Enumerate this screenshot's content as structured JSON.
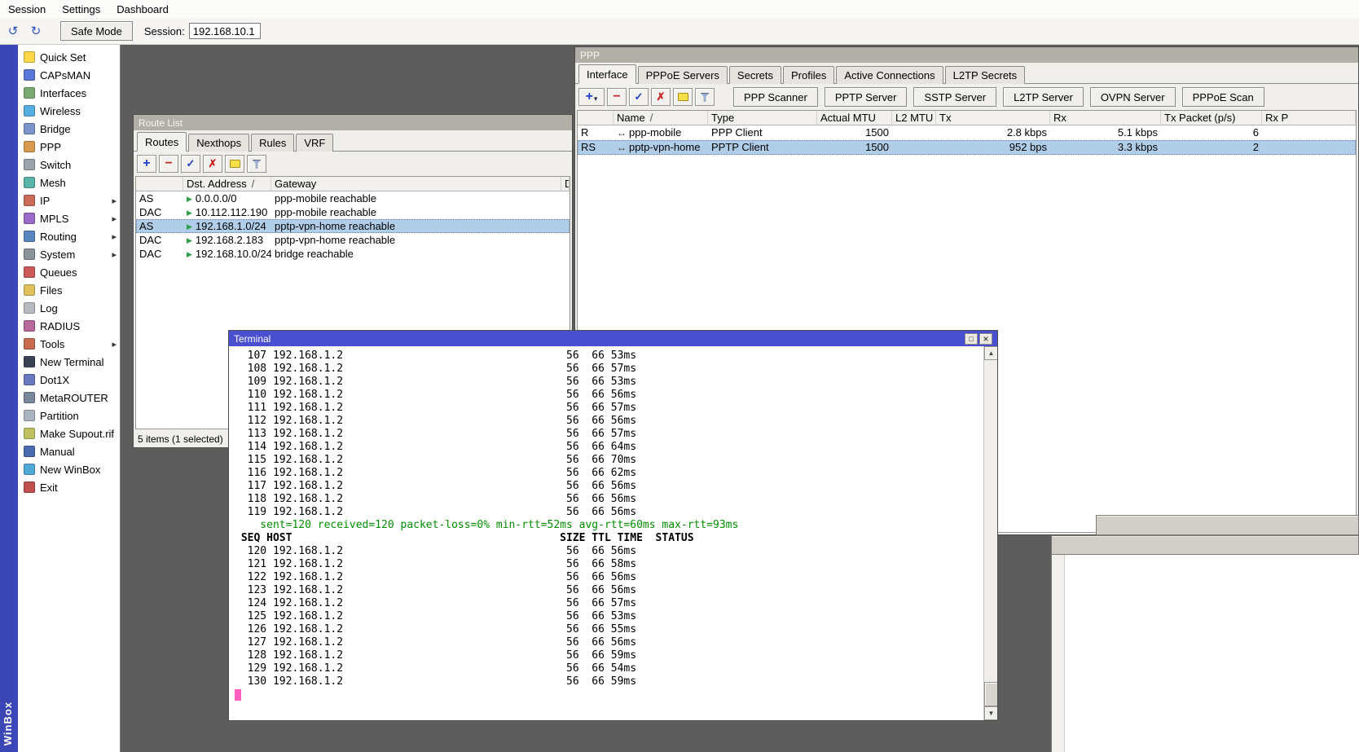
{
  "colors": {
    "workspace_bg": "#5d5d5d",
    "active_titlebar_blue": "#4a4fd0",
    "inactive_titlebar_gray": "#b2afa8",
    "selection_blue": "#b1cee9",
    "terminal_stats_green": "#008f00",
    "terminal_cursor_pink": "#ff5fbf",
    "brand_strip_blue": "#3b47b6"
  },
  "menubar": {
    "items": [
      {
        "label": "Session"
      },
      {
        "label": "Settings"
      },
      {
        "label": "Dashboard"
      }
    ]
  },
  "toolbar": {
    "safe_mode_label": "Safe Mode",
    "session_label": "Session:",
    "session_value": "192.168.10.1"
  },
  "sidebar": {
    "brand_vertical": "WinBox",
    "items": [
      {
        "label": "Quick Set",
        "icon": "quick-set",
        "arrow": ""
      },
      {
        "label": "CAPsMAN",
        "icon": "capsman",
        "arrow": ""
      },
      {
        "label": "Interfaces",
        "icon": "interfaces",
        "arrow": ""
      },
      {
        "label": "Wireless",
        "icon": "wireless",
        "arrow": ""
      },
      {
        "label": "Bridge",
        "icon": "bridge",
        "arrow": ""
      },
      {
        "label": "PPP",
        "icon": "ppp",
        "arrow": ""
      },
      {
        "label": "Switch",
        "icon": "switch",
        "arrow": ""
      },
      {
        "label": "Mesh",
        "icon": "mesh",
        "arrow": ""
      },
      {
        "label": "IP",
        "icon": "ip",
        "arrow": "▸"
      },
      {
        "label": "MPLS",
        "icon": "mpls",
        "arrow": "▸"
      },
      {
        "label": "Routing",
        "icon": "routing",
        "arrow": "▸"
      },
      {
        "label": "System",
        "icon": "system",
        "arrow": "▸"
      },
      {
        "label": "Queues",
        "icon": "queues",
        "arrow": ""
      },
      {
        "label": "Files",
        "icon": "files",
        "arrow": ""
      },
      {
        "label": "Log",
        "icon": "log",
        "arrow": ""
      },
      {
        "label": "RADIUS",
        "icon": "radius",
        "arrow": ""
      },
      {
        "label": "Tools",
        "icon": "tools",
        "arrow": "▸"
      },
      {
        "label": "New Terminal",
        "icon": "new-terminal",
        "arrow": ""
      },
      {
        "label": "Dot1X",
        "icon": "dot1x",
        "arrow": ""
      },
      {
        "label": "MetaROUTER",
        "icon": "metarouter",
        "arrow": ""
      },
      {
        "label": "Partition",
        "icon": "partition",
        "arrow": ""
      },
      {
        "label": "Make Supout.rif",
        "icon": "make-supout",
        "arrow": ""
      },
      {
        "label": "Manual",
        "icon": "manual",
        "arrow": ""
      },
      {
        "label": "New WinBox",
        "icon": "new-winbox",
        "arrow": ""
      },
      {
        "label": "Exit",
        "icon": "exit",
        "arrow": ""
      }
    ]
  },
  "route_list": {
    "title": "Route List",
    "tabs": [
      {
        "label": "Routes",
        "active": true
      },
      {
        "label": "Nexthops"
      },
      {
        "label": "Rules"
      },
      {
        "label": "VRF"
      }
    ],
    "columns": {
      "dst": "Dst. Address",
      "sort": "/",
      "gateway": "Gateway",
      "distance": "Dis"
    },
    "rows": [
      {
        "flags": "AS",
        "dst": "0.0.0.0/0",
        "gateway": "ppp-mobile reachable"
      },
      {
        "flags": "DAC",
        "dst": "10.112.112.190",
        "gateway": "ppp-mobile reachable"
      },
      {
        "flags": "AS",
        "dst": "192.168.1.0/24",
        "gateway": "pptp-vpn-home reachable",
        "selected": true
      },
      {
        "flags": "DAC",
        "dst": "192.168.2.183",
        "gateway": "pptp-vpn-home reachable"
      },
      {
        "flags": "DAC",
        "dst": "192.168.10.0/24",
        "gateway": "bridge reachable"
      }
    ],
    "status": "5 items (1 selected)"
  },
  "ppp": {
    "title": "PPP",
    "tabs": [
      {
        "label": "Interface",
        "active": true
      },
      {
        "label": "PPPoE Servers"
      },
      {
        "label": "Secrets"
      },
      {
        "label": "Profiles"
      },
      {
        "label": "Active Connections"
      },
      {
        "label": "L2TP Secrets"
      }
    ],
    "buttons": [
      {
        "label": "PPP Scanner"
      },
      {
        "label": "PPTP Server"
      },
      {
        "label": "SSTP Server"
      },
      {
        "label": "L2TP Server"
      },
      {
        "label": "OVPN Server"
      },
      {
        "label": "PPPoE Scan"
      }
    ],
    "columns": {
      "name": "Name",
      "sort": "/",
      "type": "Type",
      "actual_mtu": "Actual MTU",
      "l2_mtu": "L2 MTU",
      "tx": "Tx",
      "rx": "Rx",
      "tx_packet": "Tx Packet (p/s)",
      "rx_packet": "Rx P"
    },
    "rows": [
      {
        "flags": "R",
        "name": "ppp-mobile",
        "type": "PPP Client",
        "actual_mtu": "1500",
        "l2_mtu": "",
        "tx": "2.8 kbps",
        "rx": "5.1 kbps",
        "tx_packet": "6",
        "rx_packet": ""
      },
      {
        "flags": "RS",
        "name": "pptp-vpn-home",
        "type": "PPTP Client",
        "actual_mtu": "1500",
        "l2_mtu": "",
        "tx": "952 bps",
        "rx": "3.3 kbps",
        "tx_packet": "2",
        "rx_packet": "",
        "selected": true
      }
    ]
  },
  "terminal": {
    "title": "Terminal",
    "lines": [
      {
        "text": "  107 192.168.1.2                                   56  66 53ms"
      },
      {
        "text": "  108 192.168.1.2                                   56  66 57ms"
      },
      {
        "text": "  109 192.168.1.2                                   56  66 53ms"
      },
      {
        "text": "  110 192.168.1.2                                   56  66 56ms"
      },
      {
        "text": "  111 192.168.1.2                                   56  66 57ms"
      },
      {
        "text": "  112 192.168.1.2                                   56  66 56ms"
      },
      {
        "text": "  113 192.168.1.2                                   56  66 57ms"
      },
      {
        "text": "  114 192.168.1.2                                   56  66 64ms"
      },
      {
        "text": "  115 192.168.1.2                                   56  66 70ms"
      },
      {
        "text": "  116 192.168.1.2                                   56  66 62ms"
      },
      {
        "text": "  117 192.168.1.2                                   56  66 56ms"
      },
      {
        "text": "  118 192.168.1.2                                   56  66 56ms"
      },
      {
        "text": "  119 192.168.1.2                                   56  66 56ms"
      },
      {
        "text": "    sent=120 received=120 packet-loss=0% min-rtt=52ms avg-rtt=60ms max-rtt=93ms",
        "cls": "stats"
      },
      {
        "text": " SEQ HOST                                          SIZE TTL TIME  STATUS",
        "cls": "header"
      },
      {
        "text": "  120 192.168.1.2                                   56  66 56ms"
      },
      {
        "text": "  121 192.168.1.2                                   56  66 58ms"
      },
      {
        "text": "  122 192.168.1.2                                   56  66 56ms"
      },
      {
        "text": "  123 192.168.1.2                                   56  66 56ms"
      },
      {
        "text": "  124 192.168.1.2                                   56  66 57ms"
      },
      {
        "text": "  125 192.168.1.2                                   56  66 53ms"
      },
      {
        "text": "  126 192.168.1.2                                   56  66 55ms"
      },
      {
        "text": "  127 192.168.1.2                                   56  66 56ms"
      },
      {
        "text": "  128 192.168.1.2                                   56  66 59ms"
      },
      {
        "text": "  129 192.168.1.2                                   56  66 54ms"
      },
      {
        "text": "  130 192.168.1.2                                   56  66 59ms"
      }
    ]
  }
}
